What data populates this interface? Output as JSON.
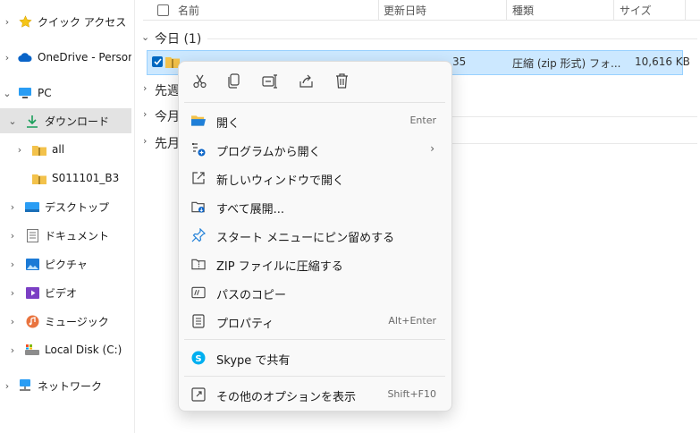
{
  "sidebar": {
    "items": [
      {
        "label": "クイック アクセス"
      },
      {
        "label": "OneDrive - Personal"
      },
      {
        "label": "PC"
      },
      {
        "label": "ダウンロード"
      },
      {
        "label": "all"
      },
      {
        "label": "S011101_B3"
      },
      {
        "label": "デスクトップ"
      },
      {
        "label": "ドキュメント"
      },
      {
        "label": "ピクチャ"
      },
      {
        "label": "ビデオ"
      },
      {
        "label": "ミュージック"
      },
      {
        "label": "Local Disk (C:)"
      },
      {
        "label": "ネットワーク"
      }
    ]
  },
  "header": {
    "name": "名前",
    "date": "更新日時",
    "type": "種類",
    "size": "サイズ"
  },
  "groups": [
    {
      "label": "今日 (1)"
    },
    {
      "label": "先週"
    },
    {
      "label": "今月"
    },
    {
      "label": "先月"
    }
  ],
  "file": {
    "time_fragment": "35",
    "type": "圧縮 (zip 形式) フォ...",
    "size": "10,616 KB"
  },
  "context_menu": {
    "items": [
      {
        "label": "開く",
        "shortcut": "Enter"
      },
      {
        "label": "プログラムから開く",
        "shortcut": ""
      },
      {
        "label": "新しいウィンドウで開く",
        "shortcut": ""
      },
      {
        "label": "すべて展開...",
        "shortcut": ""
      },
      {
        "label": "スタート メニューにピン留めする",
        "shortcut": ""
      },
      {
        "label": "ZIP ファイルに圧縮する",
        "shortcut": ""
      },
      {
        "label": "パスのコピー",
        "shortcut": ""
      },
      {
        "label": "プロパティ",
        "shortcut": "Alt+Enter"
      },
      {
        "label": "Skype で共有",
        "shortcut": ""
      },
      {
        "label": "その他のオプションを表示",
        "shortcut": "Shift+F10"
      }
    ]
  },
  "colors": {
    "accent": "#0067c0",
    "selection": "#cce8ff",
    "folder": "#f3c24b",
    "skype": "#00aff0"
  }
}
